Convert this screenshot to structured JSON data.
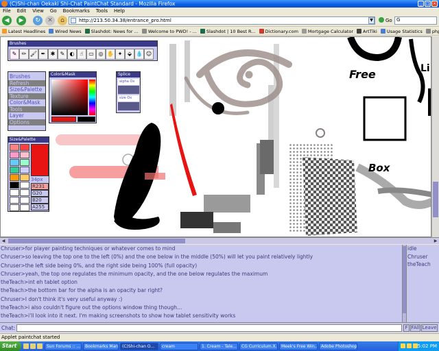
{
  "window": {
    "title": "(C)Shi-chan Oekaki Shi-Chat PaintChat Standard - Mozilla Firefox",
    "controls": [
      "_",
      "□",
      "×"
    ]
  },
  "menu": [
    "File",
    "Edit",
    "View",
    "Go",
    "Bookmarks",
    "Tools",
    "Help"
  ],
  "nav": {
    "url": "http://213.50.34.38/entrance_pro.html",
    "go_label": "Go",
    "search_value": "G"
  },
  "bookmarks": [
    "Latest Headlines",
    "Wired News",
    "Slashdot: News for ...",
    "Welcome to PWD! - ...",
    "Slashdot | 10 Best R...",
    "Dictionary.com",
    "Mortgage Calculator",
    "ArtTiki",
    "Usage Statistics",
    "phpMyAdmin 2.4.0"
  ],
  "panels": {
    "brushes_title": "Brushes",
    "color_mask_title": "Color&Mask",
    "splice_title": "Splice",
    "splice_labels": [
      "alpha Ox",
      "size Ox"
    ],
    "menu_items": [
      "Brushes",
      "Refresh",
      "Size&Palette",
      "Texture",
      "Color&Mask",
      "Tools",
      "Layer",
      "Options"
    ],
    "size_palette_title": "Size&Palette",
    "size_value": "34px",
    "rgba_values": [
      "R231",
      "G20",
      "B20",
      "A255"
    ]
  },
  "canvas_text": {
    "free": "Free",
    "box": "Box",
    "li": "Li"
  },
  "chat": {
    "messages": [
      "Chruser>for player painting techniques or whatever comes to mind",
      "Chruser>so leaving the top one to the left (0%) and the one below in the middle (50%) will let you paint relatively lightly",
      "Chruser>the left side being 0%, and the right side being 100% (full opacity)",
      "Chruser>yeah, the top one regulates the minimum opacity, and the one below regulates the maximum",
      "theTeach>int eh tablet option",
      "theTeach>the bottom bar for the alpha is an opacity bar right?",
      "Chruser>I don't think it's very useful anyway :)",
      "theTeach>i also couldn't figure out the options window thing though...",
      "theTeach>i'll look into it next. I'm making screenshots to show how tablet sensitivity works"
    ],
    "users": [
      "idle",
      "Chruser",
      "theTeach"
    ],
    "input_label": "Chat:",
    "buttons": [
      "F",
      "FAll",
      "Leave"
    ]
  },
  "status": "Applet paintchat started",
  "taskbar": {
    "start_label": "Start",
    "tasks": [
      "Sun Forums :: ...",
      "Bookmarks Man...",
      "(C)Shi-chan O...",
      "cream",
      "1. Cream - Tale...",
      "CG Curriculum.X...",
      "Meek's Free Win...",
      "Adobe Photoshop"
    ],
    "active_task": 2,
    "clock": "5:02 PM"
  },
  "colors": {
    "panel_bg": "#c8c8f0",
    "panel_text": "#4f52b8",
    "brush_red": "#e81414",
    "chat_bg": "#c9c8ee",
    "chat_text": "#3c3c7a"
  },
  "palette_swatches": [
    "#ff8080",
    "#ff4040",
    "#ff99cc",
    "#ffc0cb",
    "#66ccff",
    "#99ffcc",
    "#33cc99",
    "#ccccff",
    "#ff9900",
    "#ffcc66",
    "#000000",
    "#ffffff",
    "#ffffff",
    "#ffffff",
    "#ffffff",
    "#ffffff",
    "#ffffff",
    "#ffffff"
  ]
}
